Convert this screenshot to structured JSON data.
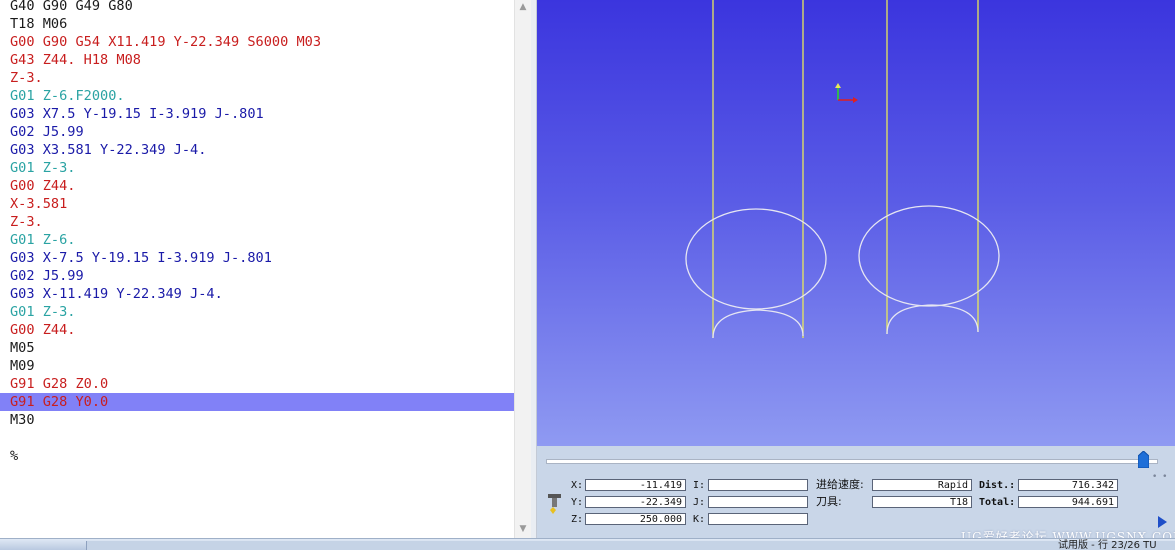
{
  "code": {
    "lines": [
      {
        "tokens": [
          {
            "t": "G40 G90 G49 G80",
            "c": "black"
          }
        ]
      },
      {
        "tokens": [
          {
            "t": "T18 M06",
            "c": "black"
          }
        ]
      },
      {
        "tokens": [
          {
            "t": "G00 G90 G54 X11.419 Y-22.349 S6000 M03",
            "c": "red"
          }
        ]
      },
      {
        "tokens": [
          {
            "t": "G43 Z44. H18 M08",
            "c": "red"
          }
        ]
      },
      {
        "tokens": [
          {
            "t": "Z-3.",
            "c": "red"
          }
        ]
      },
      {
        "tokens": [
          {
            "t": "G01 Z-6.F2000.",
            "c": "teal"
          }
        ]
      },
      {
        "tokens": [
          {
            "t": "G03 X7.5 Y-19.15 I-3.919 J-.801",
            "c": "blue"
          }
        ]
      },
      {
        "tokens": [
          {
            "t": "G02 J5.99",
            "c": "blue"
          }
        ]
      },
      {
        "tokens": [
          {
            "t": "G03 X3.581 Y-22.349 J-4.",
            "c": "blue"
          }
        ]
      },
      {
        "tokens": [
          {
            "t": "G01 Z-3.",
            "c": "teal"
          }
        ]
      },
      {
        "tokens": [
          {
            "t": "G00 Z44.",
            "c": "red"
          }
        ]
      },
      {
        "tokens": [
          {
            "t": "X-3.581",
            "c": "red"
          }
        ]
      },
      {
        "tokens": [
          {
            "t": "Z-3.",
            "c": "red"
          }
        ]
      },
      {
        "tokens": [
          {
            "t": "G01 Z-6.",
            "c": "teal"
          }
        ]
      },
      {
        "tokens": [
          {
            "t": "G03 X-7.5 Y-19.15 I-3.919 J-.801",
            "c": "blue"
          }
        ]
      },
      {
        "tokens": [
          {
            "t": "G02 J5.99",
            "c": "blue"
          }
        ]
      },
      {
        "tokens": [
          {
            "t": "G03 X-11.419 Y-22.349 J-4.",
            "c": "blue"
          }
        ]
      },
      {
        "tokens": [
          {
            "t": "G01 Z-3.",
            "c": "teal"
          }
        ]
      },
      {
        "tokens": [
          {
            "t": "G00 Z44.",
            "c": "red"
          }
        ]
      },
      {
        "tokens": [
          {
            "t": "M05",
            "c": "black"
          }
        ]
      },
      {
        "tokens": [
          {
            "t": "M09",
            "c": "black"
          }
        ]
      },
      {
        "tokens": [
          {
            "t": "G91 G28 Z0.0",
            "c": "red"
          }
        ]
      },
      {
        "tokens": [
          {
            "t": "G91 G28 Y0.0",
            "c": "red"
          }
        ],
        "selected": true
      },
      {
        "tokens": [
          {
            "t": "M30",
            "c": "black"
          }
        ]
      },
      {
        "tokens": [
          {
            "t": "",
            "c": "black"
          }
        ]
      },
      {
        "tokens": [
          {
            "t": "%",
            "c": "black"
          }
        ]
      }
    ]
  },
  "status": {
    "x_label": "X:",
    "x_value": "-11.419",
    "y_label": "Y:",
    "y_value": "-22.349",
    "z_label": "Z:",
    "z_value": "250.000",
    "i_label": "I:",
    "i_value": "",
    "j_label": "J:",
    "j_value": "",
    "k_label": "K:",
    "k_value": "",
    "feed_label": "进给速度:",
    "feed_value": "Rapid",
    "tool_label": "刀具:",
    "tool_value": "T18",
    "dist_label": "Dist.:",
    "dist_value": "716.342",
    "total_label": "Total:",
    "total_value": "944.691",
    "slider_progress": 0.98
  },
  "watermark": "UG爱好者论坛 WWW.UGSNX.COM",
  "bottom_text": "试用版 - 行 23/26 TU",
  "icons": {
    "tool": "tool-holder-icon",
    "play": "play-icon",
    "axis": "axis-triad-icon"
  }
}
